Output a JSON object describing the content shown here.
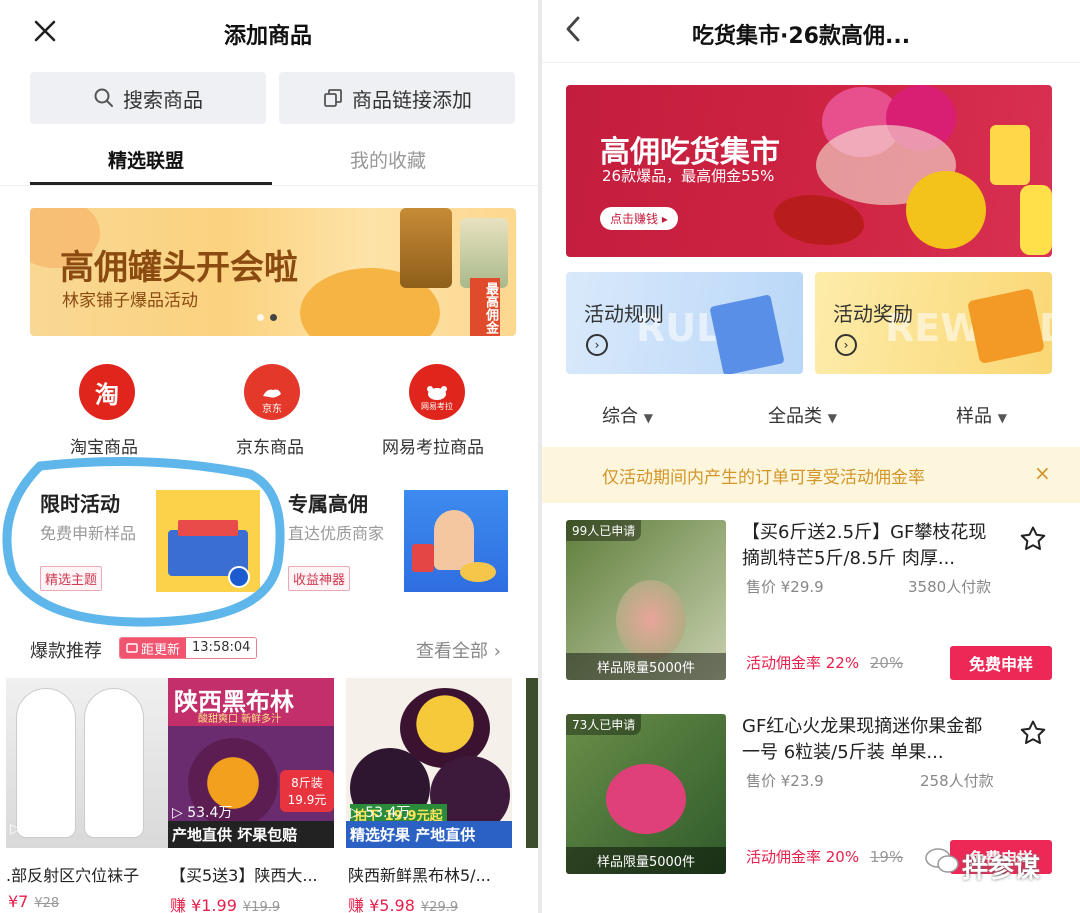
{
  "left": {
    "header": {
      "title": "添加商品",
      "close_icon": "close-icon"
    },
    "search_button": "搜索商品",
    "link_button": "商品链接添加",
    "tabs": [
      {
        "label": "精选联盟",
        "active": true
      },
      {
        "label": "我的收藏",
        "active": false
      }
    ],
    "banner": {
      "title": "高佣罐头开会啦",
      "subtitle": "林家铺子爆品活动",
      "side_text": "最高佣金"
    },
    "categories": [
      {
        "label": "淘宝商品",
        "icon_text": "淘",
        "icon": "taobao-icon"
      },
      {
        "label": "京东商品",
        "icon_text": "京东",
        "icon": "jd-icon"
      },
      {
        "label": "网易考拉商品",
        "icon_text": "网易考拉",
        "icon": "kaola-icon"
      }
    ],
    "promos": [
      {
        "title": "限时活动",
        "subtitle": "免费申新样品",
        "tag": "精选主题"
      },
      {
        "title": "专属高佣",
        "subtitle": "直达优质商家",
        "tag": "收益神器"
      }
    ],
    "hot": {
      "title": "爆款推荐",
      "countdown_label": "距更新",
      "countdown": "13:58:04",
      "see_all": "查看全部"
    },
    "products": [
      {
        "name": ".部反射区穴位袜子",
        "price": "¥7",
        "old_price": "¥28",
        "views": "53.5万",
        "overlay": ""
      },
      {
        "name": "【买5送3】陕西大...",
        "price": "赚 ¥1.99",
        "old_price": "¥19.9",
        "views": "53.4万",
        "overlay": "产地直供 坏果包赔",
        "img_title": "陕西黑布林",
        "img_sub": "酸甜爽口 新鲜多汁",
        "img_tag": "8斤装 19.9元"
      },
      {
        "name": "陕西新鲜黑布林5/...",
        "price": "赚 ¥5.98",
        "old_price": "¥29.9",
        "views": "53.4万",
        "overlay": "精选好果 产地直供",
        "img_tag": "拍下 19.9元起"
      }
    ]
  },
  "right": {
    "header": {
      "title": "吃货集市·26款高佣...",
      "back_icon": "back-icon"
    },
    "banner": {
      "title": "高佣吃货集市",
      "subtitle": "26款爆品，最高佣金55%",
      "button": "点击赚钱"
    },
    "cards": [
      {
        "label": "活动规则",
        "watermark": "RULE"
      },
      {
        "label": "活动奖励",
        "watermark": "REWARD"
      }
    ],
    "filters": [
      "综合",
      "全品类",
      "样品"
    ],
    "notice": "仅活动期间内产生的订单可享受活动佣金率",
    "items": [
      {
        "badge": "99人已申请",
        "title": "【买6斤送2.5斤】GF攀枝花现摘凯特芒5斤/8.5斤 肉厚...",
        "price_label": "售价 ¥29.9",
        "sold": "3580人付款",
        "limit": "样品限量5000件",
        "rate_label": "活动佣金率 22%",
        "old_rate": "20%",
        "button": "免费申样"
      },
      {
        "badge": "73人已申请",
        "title": "GF红心火龙果现摘迷你果金都一号 6粒装/5斤装 单果...",
        "price_label": "售价 ¥23.9",
        "sold": "258人付款",
        "limit": "样品限量5000件",
        "rate_label": "活动佣金率 20%",
        "old_rate": "19%",
        "button": "免费申样"
      }
    ],
    "watermark": "拌参谋"
  },
  "colors": {
    "accent_red": "#ee2856",
    "annotation_blue": "#5fb6ea",
    "notice_bg": "#fdf6dd"
  }
}
